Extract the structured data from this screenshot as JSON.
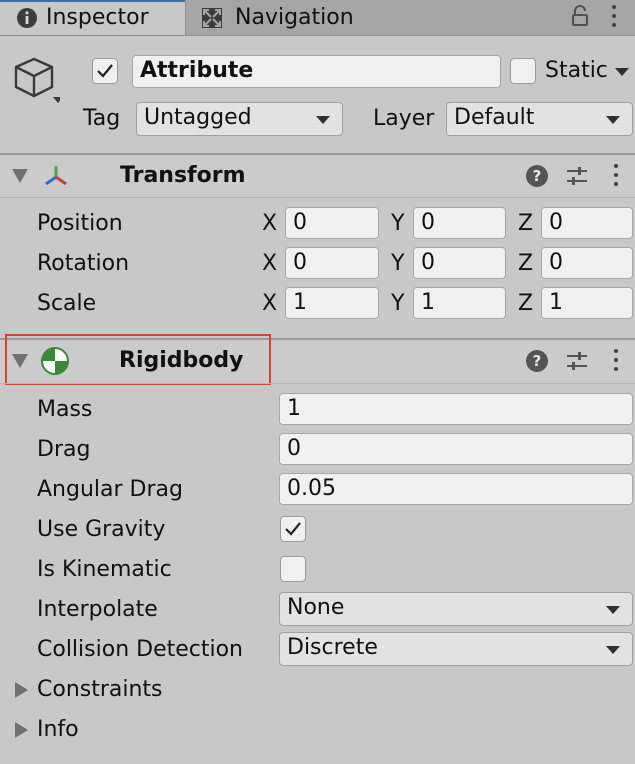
{
  "tabs": [
    {
      "label": "Inspector",
      "icon": "info-icon",
      "active": true
    },
    {
      "label": "Navigation",
      "icon": "navigation-icon",
      "active": false
    }
  ],
  "gameobject": {
    "active": true,
    "name": "Attribute",
    "static_label": "Static",
    "static": false,
    "tag_label": "Tag",
    "tag_value": "Untagged",
    "layer_label": "Layer",
    "layer_value": "Default"
  },
  "transform": {
    "title": "Transform",
    "rows": [
      {
        "label": "Position",
        "x": "0",
        "y": "0",
        "z": "0"
      },
      {
        "label": "Rotation",
        "x": "0",
        "y": "0",
        "z": "0"
      },
      {
        "label": "Scale",
        "x": "1",
        "y": "1",
        "z": "1"
      }
    ],
    "axis": {
      "x": "X",
      "y": "Y",
      "z": "Z"
    }
  },
  "rigidbody": {
    "title": "Rigidbody",
    "mass_label": "Mass",
    "mass": "1",
    "drag_label": "Drag",
    "drag": "0",
    "angular_drag_label": "Angular Drag",
    "angular_drag": "0.05",
    "use_gravity_label": "Use Gravity",
    "use_gravity": true,
    "is_kinematic_label": "Is Kinematic",
    "is_kinematic": false,
    "interpolate_label": "Interpolate",
    "interpolate": "None",
    "collision_label": "Collision Detection",
    "collision": "Discrete",
    "constraints_label": "Constraints",
    "info_label": "Info"
  },
  "colors": {
    "highlight": "#d2452b",
    "tab_accent": "#3a72b0"
  }
}
